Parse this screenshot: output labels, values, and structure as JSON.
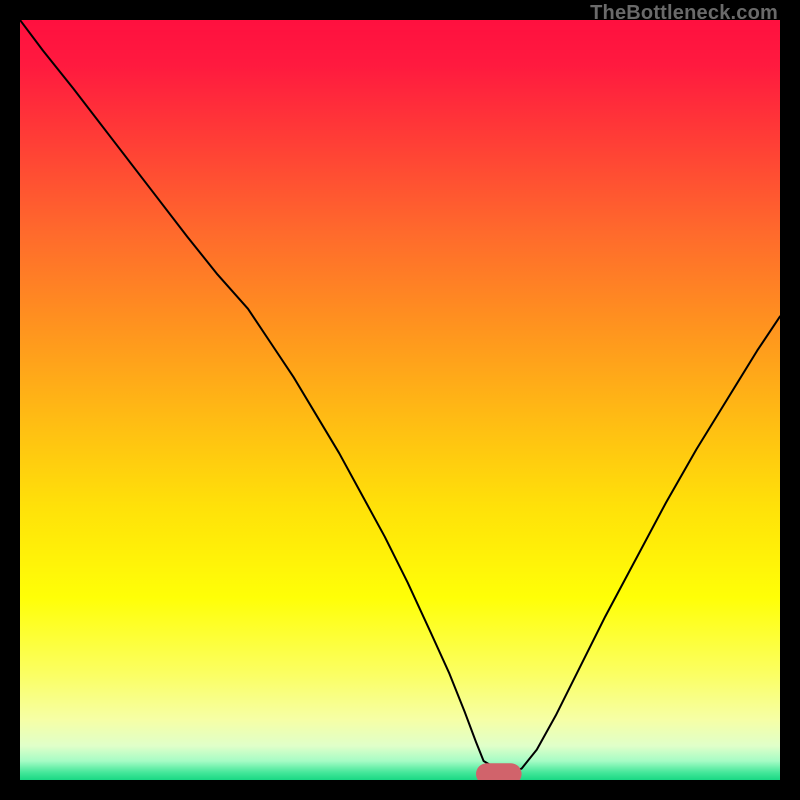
{
  "watermark": "TheBottleneck.com",
  "chart_data": {
    "type": "line",
    "title": "",
    "xlabel": "",
    "ylabel": "",
    "xlim": [
      0,
      100
    ],
    "ylim": [
      0,
      100
    ],
    "legend": false,
    "grid": false,
    "background_gradient": {
      "stops": [
        {
          "pos": 0.0,
          "color": "#ff103f"
        },
        {
          "pos": 0.06,
          "color": "#ff1a3f"
        },
        {
          "pos": 0.16,
          "color": "#ff3e36"
        },
        {
          "pos": 0.28,
          "color": "#ff6a2c"
        },
        {
          "pos": 0.4,
          "color": "#ff921f"
        },
        {
          "pos": 0.52,
          "color": "#ffba14"
        },
        {
          "pos": 0.64,
          "color": "#ffe109"
        },
        {
          "pos": 0.76,
          "color": "#ffff07"
        },
        {
          "pos": 0.86,
          "color": "#fbff62"
        },
        {
          "pos": 0.92,
          "color": "#f6ffa5"
        },
        {
          "pos": 0.955,
          "color": "#e0ffc9"
        },
        {
          "pos": 0.975,
          "color": "#a6fcc5"
        },
        {
          "pos": 0.99,
          "color": "#45e79a"
        },
        {
          "pos": 1.0,
          "color": "#19d884"
        }
      ]
    },
    "series": [
      {
        "name": "bottleneck-curve",
        "color": "#000000",
        "stroke_width": 2,
        "x": [
          0,
          3,
          7,
          12,
          17,
          22,
          26,
          30,
          33,
          36,
          39,
          42,
          45,
          48,
          51,
          54,
          56.5,
          58.5,
          60.0,
          61.0,
          63.5,
          64.5,
          66.0,
          68.0,
          70.5,
          73.5,
          77.0,
          81.0,
          85.0,
          89.0,
          93.0,
          97.0,
          100.0
        ],
        "y": [
          100,
          96,
          91,
          84.5,
          78,
          71.5,
          66.5,
          62,
          57.5,
          53,
          48,
          43,
          37.5,
          32,
          26,
          19.5,
          14,
          9,
          5,
          2.5,
          1.0,
          0.9,
          1.5,
          4,
          8.5,
          14.5,
          21.5,
          29,
          36.5,
          43.5,
          50,
          56.5,
          61
        ]
      }
    ],
    "marker": {
      "name": "optimal-point",
      "color": "#d1636b",
      "shape": "rounded-rect",
      "x": 63.0,
      "y": 0.8,
      "rx": 3.0,
      "ry": 1.4
    }
  }
}
